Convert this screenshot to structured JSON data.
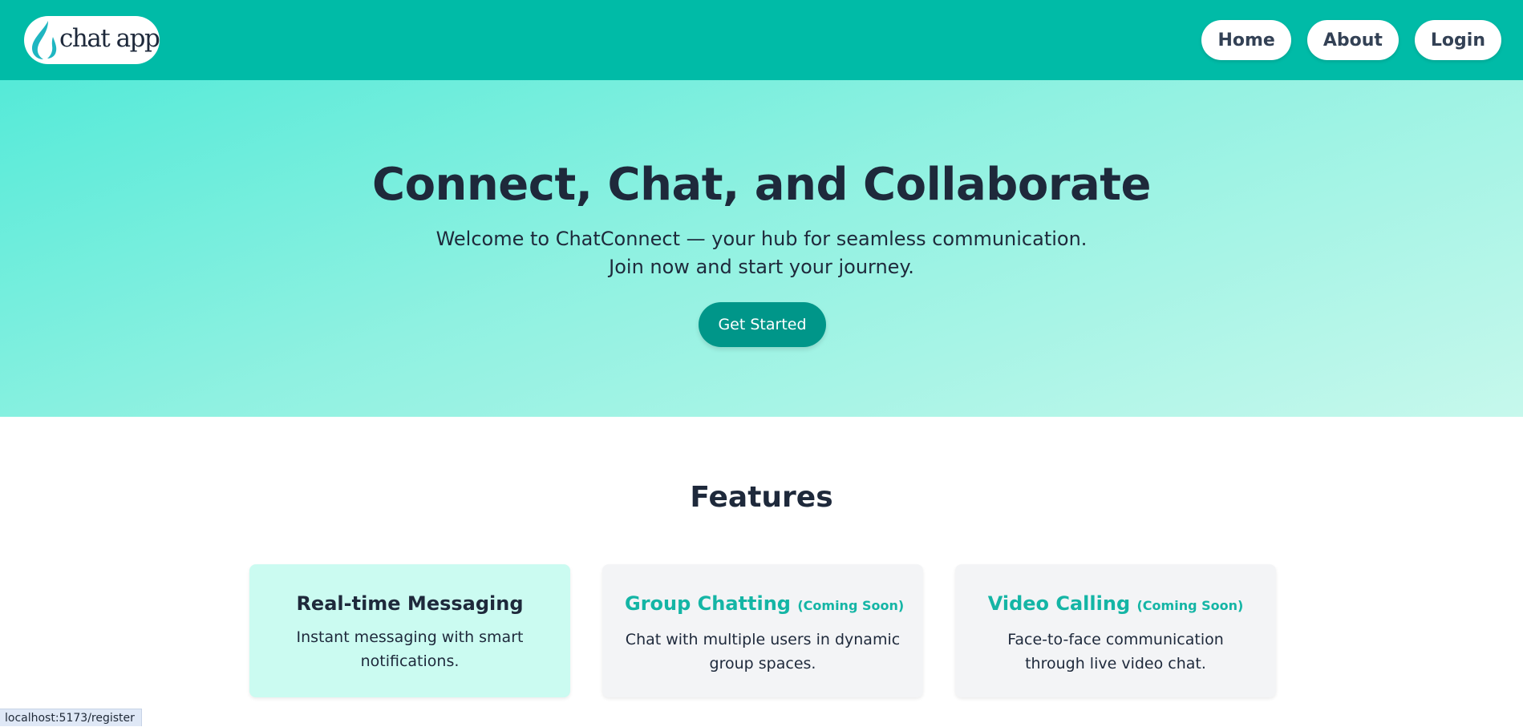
{
  "header": {
    "logo_text": "chat app",
    "logo_icon": "droplet-icon",
    "nav": [
      {
        "label": "Home"
      },
      {
        "label": "About"
      },
      {
        "label": "Login"
      }
    ]
  },
  "hero": {
    "title": "Connect, Chat, and Collaborate",
    "subtitle": "Welcome to ChatConnect — your hub for seamless communication. Join now and start your journey.",
    "cta_label": "Get Started"
  },
  "features": {
    "title": "Features",
    "cards": [
      {
        "title": "Real-time Messaging",
        "badge": "",
        "description": "Instant messaging with smart notifications."
      },
      {
        "title": "Group Chatting",
        "badge": "(Coming Soon)",
        "description": "Chat with multiple users in dynamic group spaces."
      },
      {
        "title": "Video Calling",
        "badge": "(Coming Soon)",
        "description": "Face-to-face communication through live video chat."
      }
    ]
  },
  "status_bar": {
    "url": "localhost:5173/register"
  },
  "colors": {
    "header_bg": "#00bba7",
    "accent": "#009689",
    "accent_text": "#14b5a5",
    "active_card_bg": "#cbfbf1",
    "card_bg": "#f3f4f6",
    "heading_text": "#1e293b"
  }
}
